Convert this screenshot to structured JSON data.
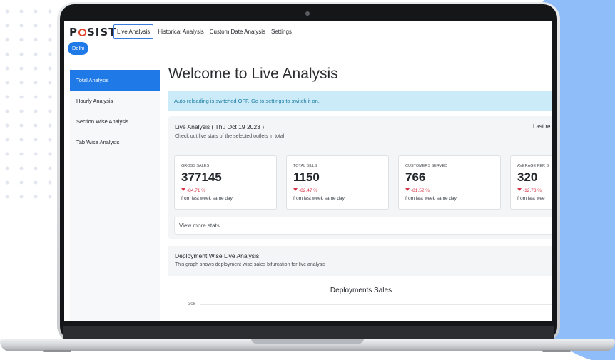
{
  "brand": {
    "logo_left": "P",
    "logo_right": "SIST"
  },
  "nav": {
    "items": [
      {
        "label": "Live Analysis",
        "active": true
      },
      {
        "label": "Historical Analysis",
        "active": false
      },
      {
        "label": "Custom Date Analysis",
        "active": false
      },
      {
        "label": "Settings",
        "active": false
      }
    ]
  },
  "city_badge": "Delhi",
  "sidebar": {
    "items": [
      {
        "label": "Total Analysis",
        "active": true
      },
      {
        "label": "Hourly Analysis",
        "active": false
      },
      {
        "label": "Section Wise Analysis",
        "active": false
      },
      {
        "label": "Tab Wise Analysis",
        "active": false
      }
    ]
  },
  "main": {
    "title": "Welcome to Live Analysis",
    "alert": "Auto-reloading is switched OFF. Go to settings to switch it on.",
    "live_panel": {
      "title": "Live Analysis ( Thu Oct 19 2023 )",
      "subtitle": "Check out live stats of the selected outlets in total",
      "right_label": "Last re"
    },
    "stats": [
      {
        "label": "GROSS SALES",
        "value": "377145",
        "change": "-84.71 %",
        "note": "from last week same day"
      },
      {
        "label": "TOTAL BILLS",
        "value": "1150",
        "change": "-82.47 %",
        "note": "from last week same day"
      },
      {
        "label": "CUSTOMERS SERVED",
        "value": "766",
        "change": "-81.52 %",
        "note": "from last week same day"
      },
      {
        "label": "AVERAGE PER B",
        "value": "320",
        "change": "-12.73 %",
        "note": "from last wee"
      }
    ],
    "more_stats_label": "View more stats",
    "deployment": {
      "title": "Deployment Wise Live Analysis",
      "subtitle": "This graph shows deployment wise sales bifurcation for live analysis",
      "chart_title": "Deployments Sales",
      "y_tick": "30k"
    }
  },
  "colors": {
    "accent": "#1f7ae8",
    "negative": "#d7364a",
    "alert_bg": "#ccebf8",
    "alert_text": "#1c7ca3",
    "logo_ring": "#e2462d"
  }
}
